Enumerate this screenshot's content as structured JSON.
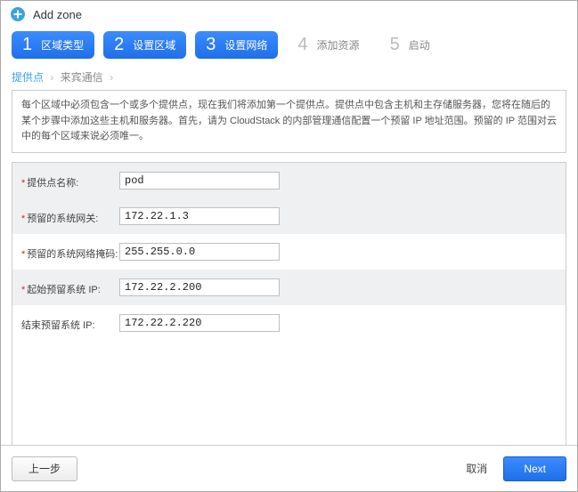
{
  "header": {
    "title": "Add zone"
  },
  "steps": [
    {
      "num": "1",
      "label": "区域类型",
      "active": true
    },
    {
      "num": "2",
      "label": "设置区域",
      "active": true
    },
    {
      "num": "3",
      "label": "设置网络",
      "active": true
    },
    {
      "num": "4",
      "label": "添加资源",
      "active": false
    },
    {
      "num": "5",
      "label": "启动",
      "active": false
    }
  ],
  "breadcrumb": {
    "c1": "提供点",
    "c2": "来宾通信"
  },
  "description": "每个区域中必须包含一个或多个提供点，现在我们将添加第一个提供点。提供点中包含主机和主存储服务器，您将在随后的某个步骤中添加这些主机和服务器。首先，请为 CloudStack 的内部管理通信配置一个预留 IP 地址范围。预留的 IP 范围对云中的每个区域来说必须唯一。",
  "form": {
    "pod_name": {
      "label": "提供点名称:",
      "value": "pod",
      "required": true
    },
    "reserved_gateway": {
      "label": "预留的系统网关:",
      "value": "172.22.1.3",
      "required": true
    },
    "reserved_netmask": {
      "label": "预留的系统网络掩码:",
      "value": "255.255.0.0",
      "required": true
    },
    "start_ip": {
      "label": "起始预留系统 IP:",
      "value": "172.22.2.200",
      "required": true
    },
    "end_ip": {
      "label": "结束预留系统 IP:",
      "value": "172.22.2.220",
      "required": false
    }
  },
  "footer": {
    "prev": "上一步",
    "cancel": "取消",
    "next": "Next"
  }
}
